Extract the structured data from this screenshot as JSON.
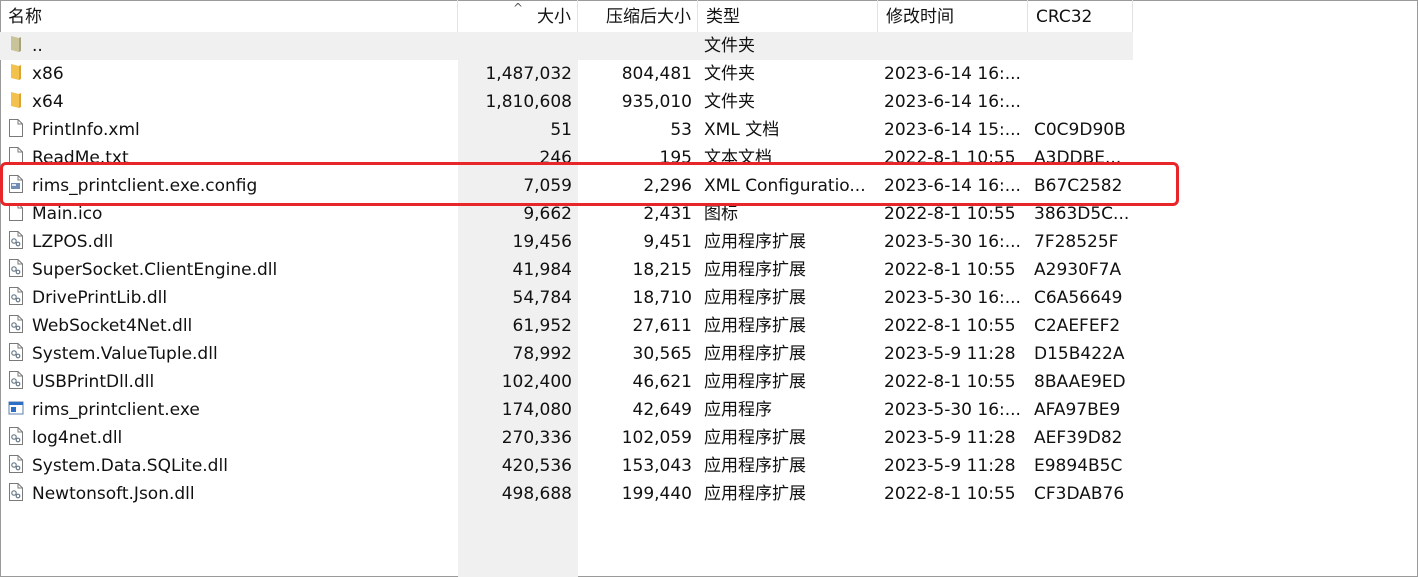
{
  "columns": {
    "name": "名称",
    "size": "大小",
    "compressed": "压缩后大小",
    "type": "类型",
    "modified": "修改时间",
    "crc": "CRC32"
  },
  "sort_indicator": "^",
  "rows": [
    {
      "name": "..",
      "icon": "folder-up-icon",
      "size": "",
      "compressed": "",
      "type": "文件夹",
      "modified": "",
      "crc": ""
    },
    {
      "name": "x86",
      "icon": "folder-icon",
      "size": "1,487,032",
      "compressed": "804,481",
      "type": "文件夹",
      "modified": "2023-6-14 16:...",
      "crc": ""
    },
    {
      "name": "x64",
      "icon": "folder-icon",
      "size": "1,810,608",
      "compressed": "935,010",
      "type": "文件夹",
      "modified": "2023-6-14 16:...",
      "crc": ""
    },
    {
      "name": "PrintInfo.xml",
      "icon": "file-icon",
      "size": "51",
      "compressed": "53",
      "type": "XML 文档",
      "modified": "2023-6-14 15:...",
      "crc": "C0C9D90B"
    },
    {
      "name": "ReadMe.txt",
      "icon": "file-icon",
      "size": "246",
      "compressed": "195",
      "type": "文本文档",
      "modified": "2022-8-1 10:55",
      "crc": "A3DDBE..."
    },
    {
      "name": "rims_printclient.exe.config",
      "icon": "config-file-icon",
      "size": "7,059",
      "compressed": "2,296",
      "type": "XML Configuratio...",
      "modified": "2023-6-14 16:...",
      "crc": "B67C2582"
    },
    {
      "name": "Main.ico",
      "icon": "file-icon",
      "size": "9,662",
      "compressed": "2,431",
      "type": "图标",
      "modified": "2022-8-1 10:55",
      "crc": "3863D5C..."
    },
    {
      "name": "LZPOS.dll",
      "icon": "dll-icon",
      "size": "19,456",
      "compressed": "9,451",
      "type": "应用程序扩展",
      "modified": "2023-5-30 16:...",
      "crc": "7F28525F"
    },
    {
      "name": "SuperSocket.ClientEngine.dll",
      "icon": "dll-icon",
      "size": "41,984",
      "compressed": "18,215",
      "type": "应用程序扩展",
      "modified": "2022-8-1 10:55",
      "crc": "A2930F7A"
    },
    {
      "name": "DrivePrintLib.dll",
      "icon": "dll-icon",
      "size": "54,784",
      "compressed": "18,710",
      "type": "应用程序扩展",
      "modified": "2023-5-30 16:...",
      "crc": "C6A56649"
    },
    {
      "name": "WebSocket4Net.dll",
      "icon": "dll-icon",
      "size": "61,952",
      "compressed": "27,611",
      "type": "应用程序扩展",
      "modified": "2022-8-1 10:55",
      "crc": "C2AEFEF2"
    },
    {
      "name": "System.ValueTuple.dll",
      "icon": "dll-icon",
      "size": "78,992",
      "compressed": "30,565",
      "type": "应用程序扩展",
      "modified": "2023-5-9 11:28",
      "crc": "D15B422A"
    },
    {
      "name": "USBPrintDll.dll",
      "icon": "dll-icon",
      "size": "102,400",
      "compressed": "46,621",
      "type": "应用程序扩展",
      "modified": "2022-8-1 10:55",
      "crc": "8BAAE9ED"
    },
    {
      "name": "rims_printclient.exe",
      "icon": "exe-icon",
      "size": "174,080",
      "compressed": "42,649",
      "type": "应用程序",
      "modified": "2023-5-30 16:...",
      "crc": "AFA97BE9"
    },
    {
      "name": "log4net.dll",
      "icon": "dll-icon",
      "size": "270,336",
      "compressed": "102,059",
      "type": "应用程序扩展",
      "modified": "2023-5-9 11:28",
      "crc": "AEF39D82"
    },
    {
      "name": "System.Data.SQLite.dll",
      "icon": "dll-icon",
      "size": "420,536",
      "compressed": "153,043",
      "type": "应用程序扩展",
      "modified": "2023-5-9 11:28",
      "crc": "E9894B5C"
    },
    {
      "name": "Newtonsoft.Json.dll",
      "icon": "dll-icon",
      "size": "498,688",
      "compressed": "199,440",
      "type": "应用程序扩展",
      "modified": "2022-8-1 10:55",
      "crc": "CF3DAB76"
    }
  ],
  "colors": {
    "highlight_border": "#e8262a",
    "sorted_column_bg": "#f0f0f0",
    "folder": "#f2c14e"
  }
}
